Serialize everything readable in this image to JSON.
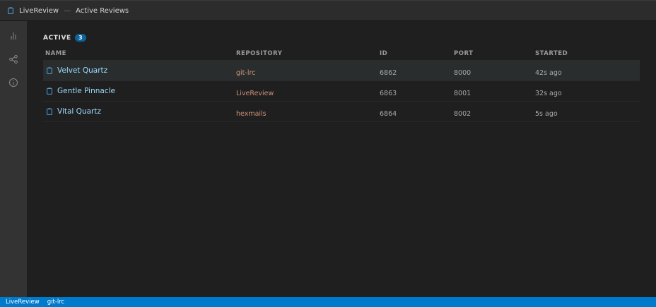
{
  "titlebar": {
    "app_name": "LiveReview",
    "separator": "—",
    "view_name": "Active Reviews"
  },
  "activitybar": {
    "icons": [
      "bar-chart-icon",
      "share-icon",
      "info-icon"
    ]
  },
  "section": {
    "title": "ACTIVE",
    "count": "3"
  },
  "table": {
    "headers": {
      "name": "NAME",
      "repository": "REPOSITORY",
      "id": "ID",
      "port": "PORT",
      "started": "STARTED"
    },
    "rows": [
      {
        "name": "Velvet Quartz",
        "repository": "git-lrc",
        "id": "6862",
        "port": "8000",
        "started": "42s ago",
        "selected": true
      },
      {
        "name": "Gentle Pinnacle",
        "repository": "LiveReview",
        "id": "6863",
        "port": "8001",
        "started": "32s ago",
        "selected": false
      },
      {
        "name": "Vital Quartz",
        "repository": "hexmails",
        "id": "6864",
        "port": "8002",
        "started": "5s ago",
        "selected": false
      }
    ]
  },
  "statusbar": {
    "app": "LiveReview",
    "branch": "git-lrc"
  },
  "colors": {
    "accent": "#007acc",
    "badge": "#0e639c",
    "name_text": "#9cdcfe",
    "repo_text": "#ce9178"
  }
}
